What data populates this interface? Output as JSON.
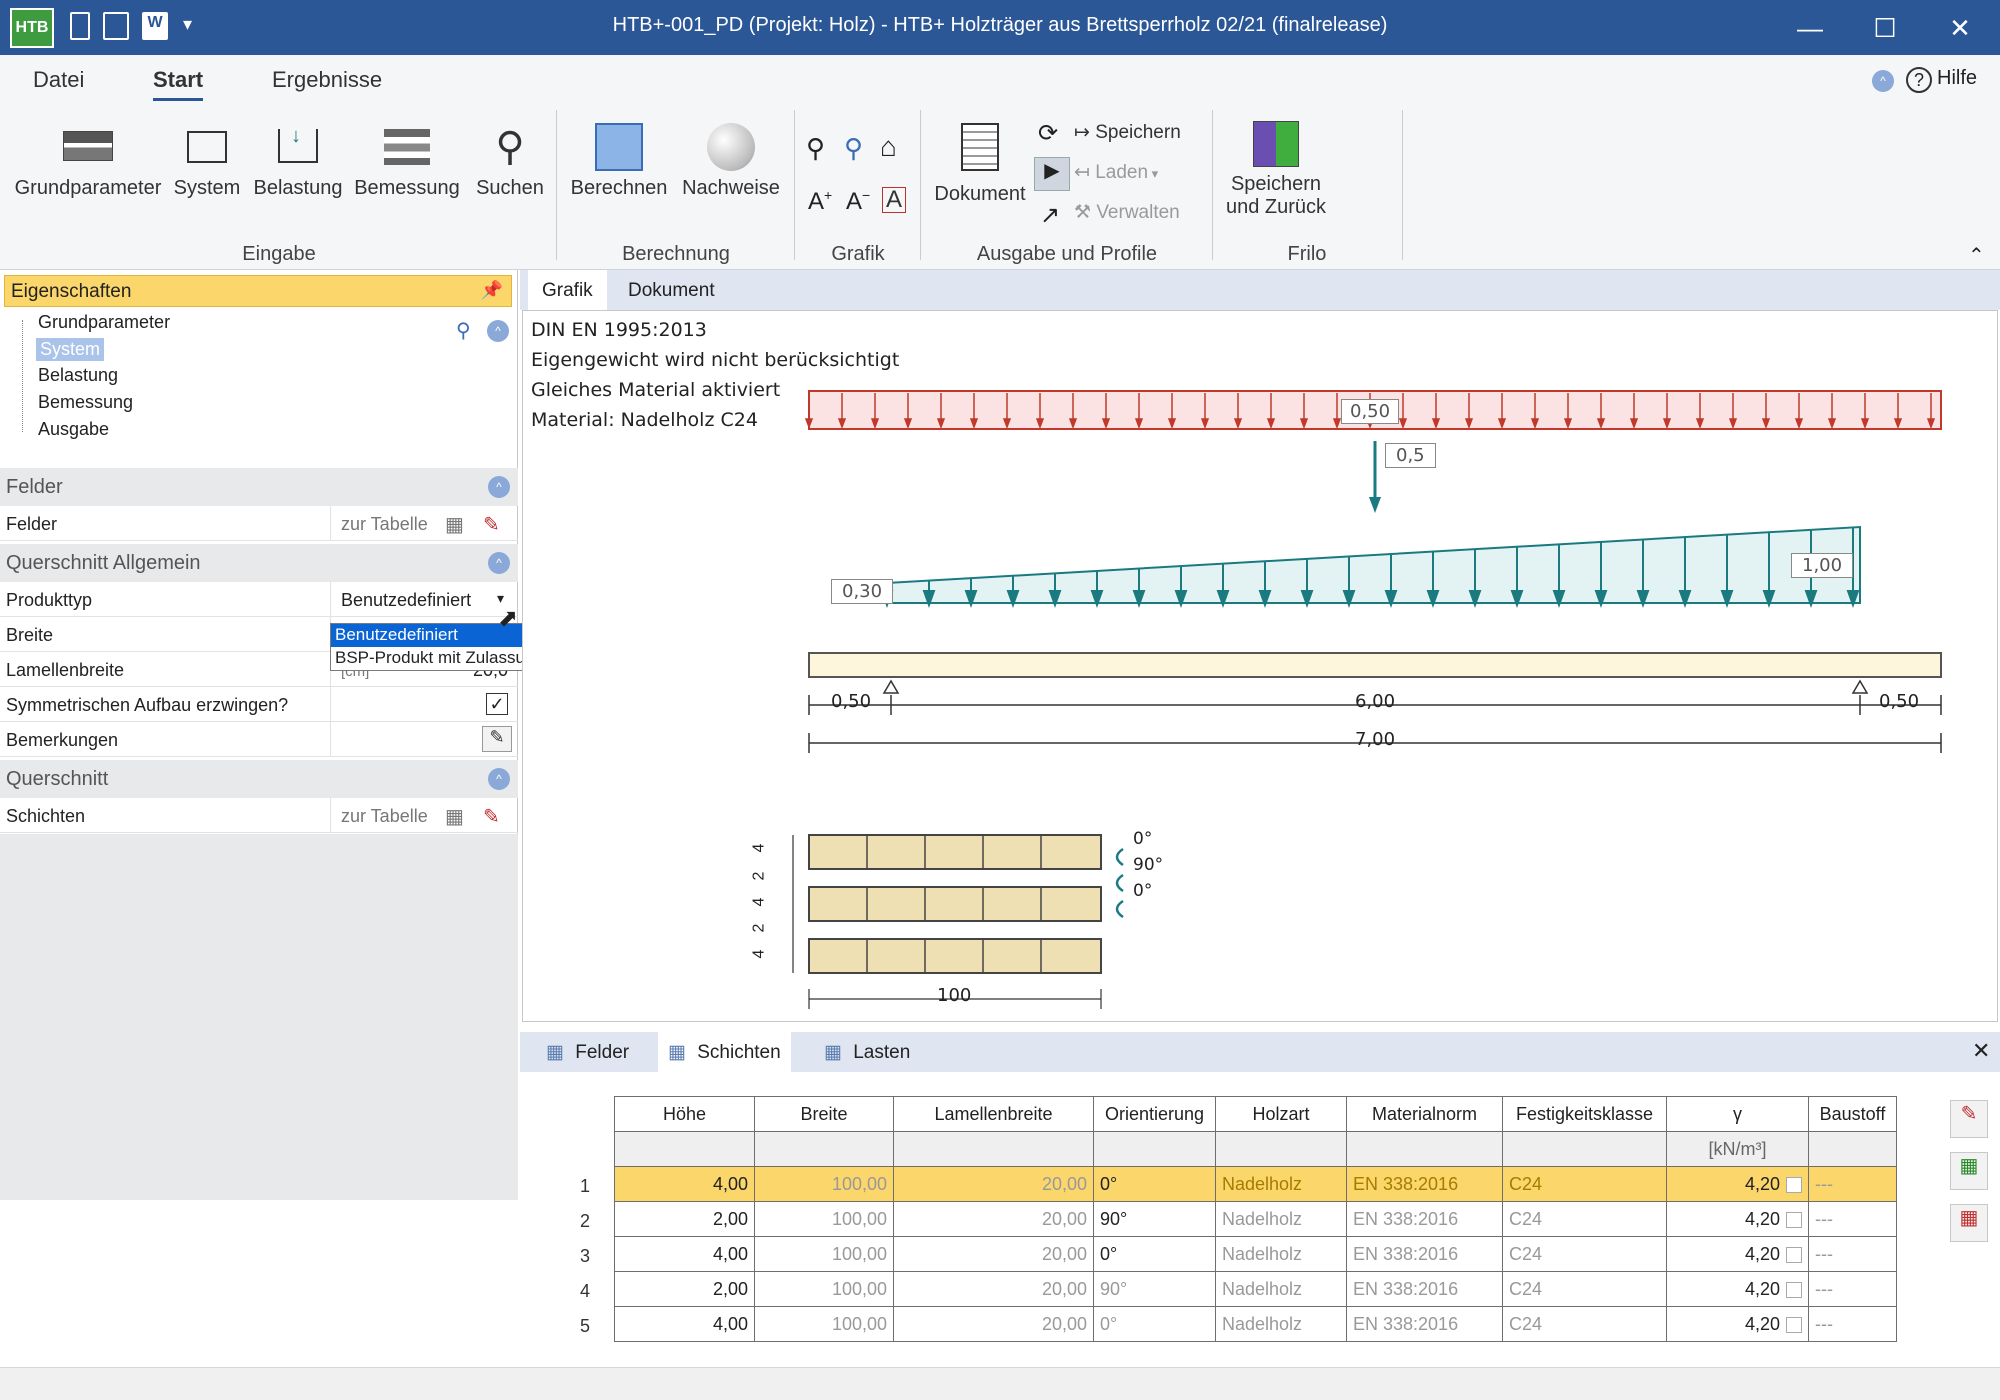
{
  "titlebar": {
    "title": "HTB+-001_PD (Projekt: Holz) - HTB+ Holzträger aus Brettsperrholz 02/21 (finalrelease)",
    "logo": "HTB"
  },
  "ribbon_tabs": [
    "Datei",
    "Start",
    "Ergebnisse"
  ],
  "help_label": "Hilfe",
  "ribbon": {
    "grundparameter": "Grundparameter",
    "system": "System",
    "belastung": "Belastung",
    "bemessung": "Bemessung",
    "suchen": "Suchen",
    "group_eingabe": "Eingabe",
    "berechnen": "Berechnen",
    "nachweise": "Nachweise",
    "group_berechnung": "Berechnung",
    "group_grafik": "Grafik",
    "dokument": "Dokument",
    "speichern": "Speichern",
    "laden": "Laden",
    "verwalten": "Verwalten",
    "group_ausgabe": "Ausgabe und Profile",
    "speichern_zurueck_1": "Speichern",
    "speichern_zurueck_2": "und Zurück",
    "group_frilo": "Frilo"
  },
  "left_panel": {
    "header": "Eigenschaften",
    "tree": [
      "Grundparameter",
      "System",
      "Belastung",
      "Bemessung",
      "Ausgabe"
    ],
    "sections": {
      "felder": "Felder",
      "querschnitt_allgemein": "Querschnitt Allgemein",
      "querschnitt": "Querschnitt"
    },
    "rows": {
      "felder_label": "Felder",
      "felder_value": "zur Tabelle",
      "produkttyp_label": "Produkttyp",
      "produkttyp_value": "Benutzedefiniert",
      "breite_label": "Breite",
      "lamellen_label": "Lamellenbreite",
      "lamellen_unit": "[cm]",
      "lamellen_value": "20,0",
      "sym_label": "Symmetrischen Aufbau erzwingen?",
      "bemerk_label": "Bemerkungen",
      "schichten_label": "Schichten",
      "schichten_value": "zur Tabelle"
    },
    "dropdown_options": [
      "Benutzedefiniert",
      "BSP-Produkt mit Zulassung"
    ]
  },
  "canvas_tabs": [
    "Grafik",
    "Dokument"
  ],
  "drawing": {
    "info": [
      "DIN EN 1995:2013",
      "Eigengewicht wird nicht berücksichtigt",
      "Gleiches Material aktiviert",
      "Material: Nadelholz C24"
    ],
    "load_uniform": "0,50",
    "load_point": "0,5",
    "load_trap_start": "0,30",
    "load_trap_end": "1,00",
    "dim_left": "0,50",
    "dim_span": "6,00",
    "dim_right": "0,50",
    "dim_total": "7,00",
    "layer_dims": [
      "4",
      "2",
      "4",
      "2",
      "4"
    ],
    "layer_angles": [
      "0°",
      "90°",
      "0°"
    ],
    "width_label": "100"
  },
  "bottom_tabs": [
    "Felder",
    "Schichten",
    "Lasten"
  ],
  "table": {
    "headers": [
      "Höhe",
      "Breite",
      "Lamellenbreite",
      "Orientierung",
      "Holzart",
      "Materialnorm",
      "Festigkeitsklasse",
      "γ",
      "Baustoff"
    ],
    "units": [
      "",
      "",
      "",
      "",
      "",
      "",
      "",
      "[kN/m³]",
      ""
    ],
    "rows": [
      {
        "n": "1",
        "hoehe": "4,00",
        "breite": "100,00",
        "lamelle": "20,00",
        "orient": "0°",
        "holz": "Nadelholz",
        "norm": "EN 338:2016",
        "klasse": "C24",
        "gamma": "4,20",
        "baustoff": "---"
      },
      {
        "n": "2",
        "hoehe": "2,00",
        "breite": "100,00",
        "lamelle": "20,00",
        "orient": "90°",
        "holz": "Nadelholz",
        "norm": "EN 338:2016",
        "klasse": "C24",
        "gamma": "4,20",
        "baustoff": "---"
      },
      {
        "n": "3",
        "hoehe": "4,00",
        "breite": "100,00",
        "lamelle": "20,00",
        "orient": "0°",
        "holz": "Nadelholz",
        "norm": "EN 338:2016",
        "klasse": "C24",
        "gamma": "4,20",
        "baustoff": "---"
      },
      {
        "n": "4",
        "hoehe": "2,00",
        "breite": "100,00",
        "lamelle": "20,00",
        "orient": "90°",
        "holz": "Nadelholz",
        "norm": "EN 338:2016",
        "klasse": "C24",
        "gamma": "4,20",
        "baustoff": "---"
      },
      {
        "n": "5",
        "hoehe": "4,00",
        "breite": "100,00",
        "lamelle": "20,00",
        "orient": "0°",
        "holz": "Nadelholz",
        "norm": "EN 338:2016",
        "klasse": "C24",
        "gamma": "4,20",
        "baustoff": "---"
      }
    ]
  },
  "colors": {
    "titlebar": "#2b5797",
    "selection": "#fbd66a",
    "load_red": "#c0392b",
    "load_teal": "#1a7a80"
  }
}
